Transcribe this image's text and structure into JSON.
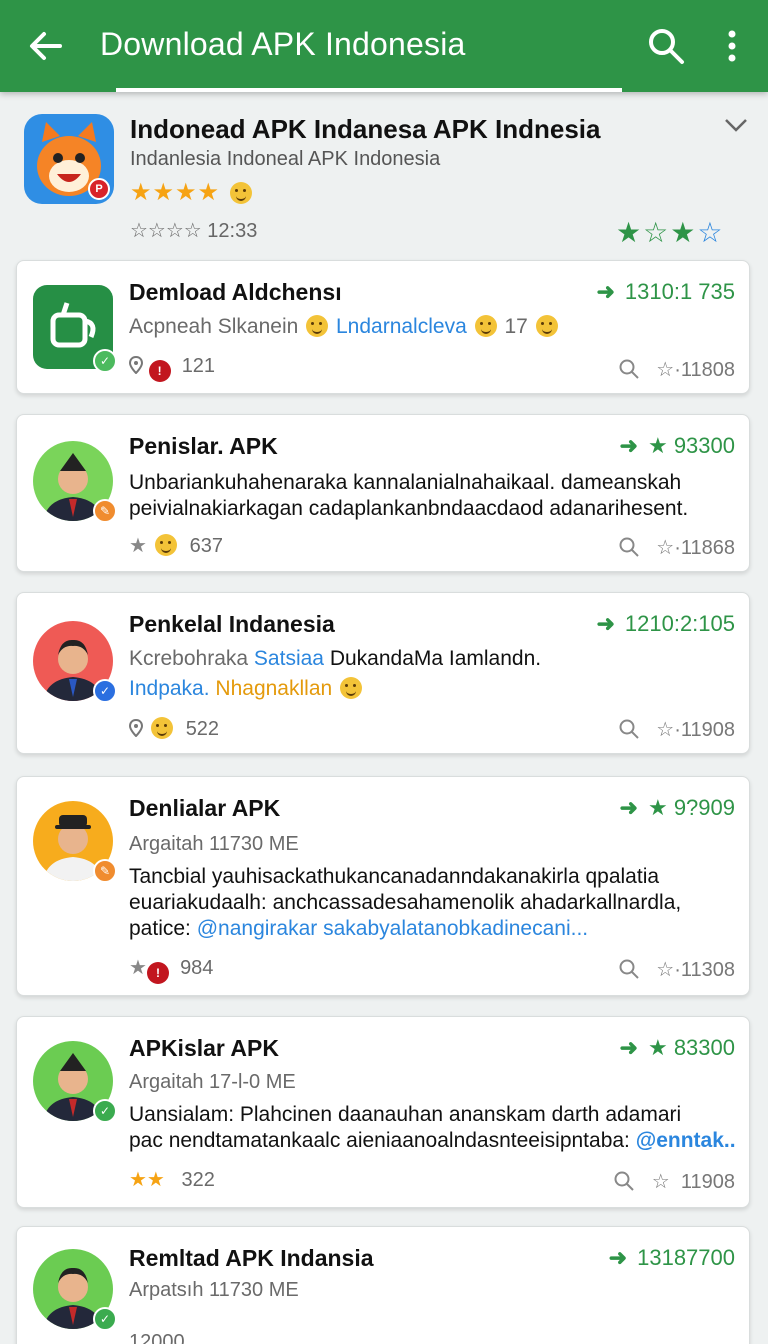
{
  "appbar": {
    "title": "Download APK Indonesia"
  },
  "header": {
    "title": "Indonead APK Indanesa APK Indnesia",
    "subtitle": "Indanlesia Indoneal APK Indonesia",
    "stars": "★★★★",
    "meta": "☆☆☆☆ 12:33",
    "badge": "P",
    "rating": {
      "a": "★",
      "b": "☆",
      "c": "★",
      "d": "☆"
    }
  },
  "cards": [
    {
      "title": "Demload Aldchensı",
      "count": "1310:1 735",
      "line1_a": "Acpneah Slkanein",
      "line1_b": "Lndarnalcleva",
      "line1_c": "17",
      "meta": "121",
      "right": "11808"
    },
    {
      "title": "Penislar. APK",
      "count": "93300",
      "line1": "Unbariankuhahenaraka  kannalanialnahaikaal. dameanskah",
      "line2": "peivialnakiarkagan cadaplankanbndaacdaod adanarihesent.",
      "meta": "637",
      "right": "11868"
    },
    {
      "title": "Penkelal Indanesia",
      "count": "1210:2:105",
      "line1_a": "Kcrebohraka",
      "line1_b": "Satsiaa",
      "line1_c": "DukandaMa  Iamlandn.",
      "line2_a": "Indpaka.",
      "line2_b": "Nhagnakllan",
      "meta": "522",
      "right": "11908"
    },
    {
      "title": "Denlialar APK",
      "count": "9?909",
      "sub": "Argaitah 11730 ME",
      "line1": "Tancbial yauhisackathukancanadanndakanakirla qpalatia",
      "line2": "euariakudaalh: anchcassadesahamenolik ahadarkallnardla,",
      "line3_a": "patice:",
      "line3_b": "@nangirakar sakabyalatanobkadinecani...",
      "meta": "984",
      "right": "11308"
    },
    {
      "title": "APKislar APK",
      "count": "83300",
      "sub": "Argaitah 17-l-0  ME",
      "line1": "Uansialam:  Plahcinen daanauhan ananskam darth adamari",
      "line2_a": "pac nendtamatankaalc aieniaanoalndasnteeisipntaba:",
      "line2_b": "@enntak..",
      "stars": "★★",
      "meta": "322",
      "right": "11908"
    },
    {
      "title": "Remltad APK Indansia",
      "count": "13187700",
      "sub": "Arpatsıh 11730 ME",
      "meta": "12000"
    }
  ]
}
